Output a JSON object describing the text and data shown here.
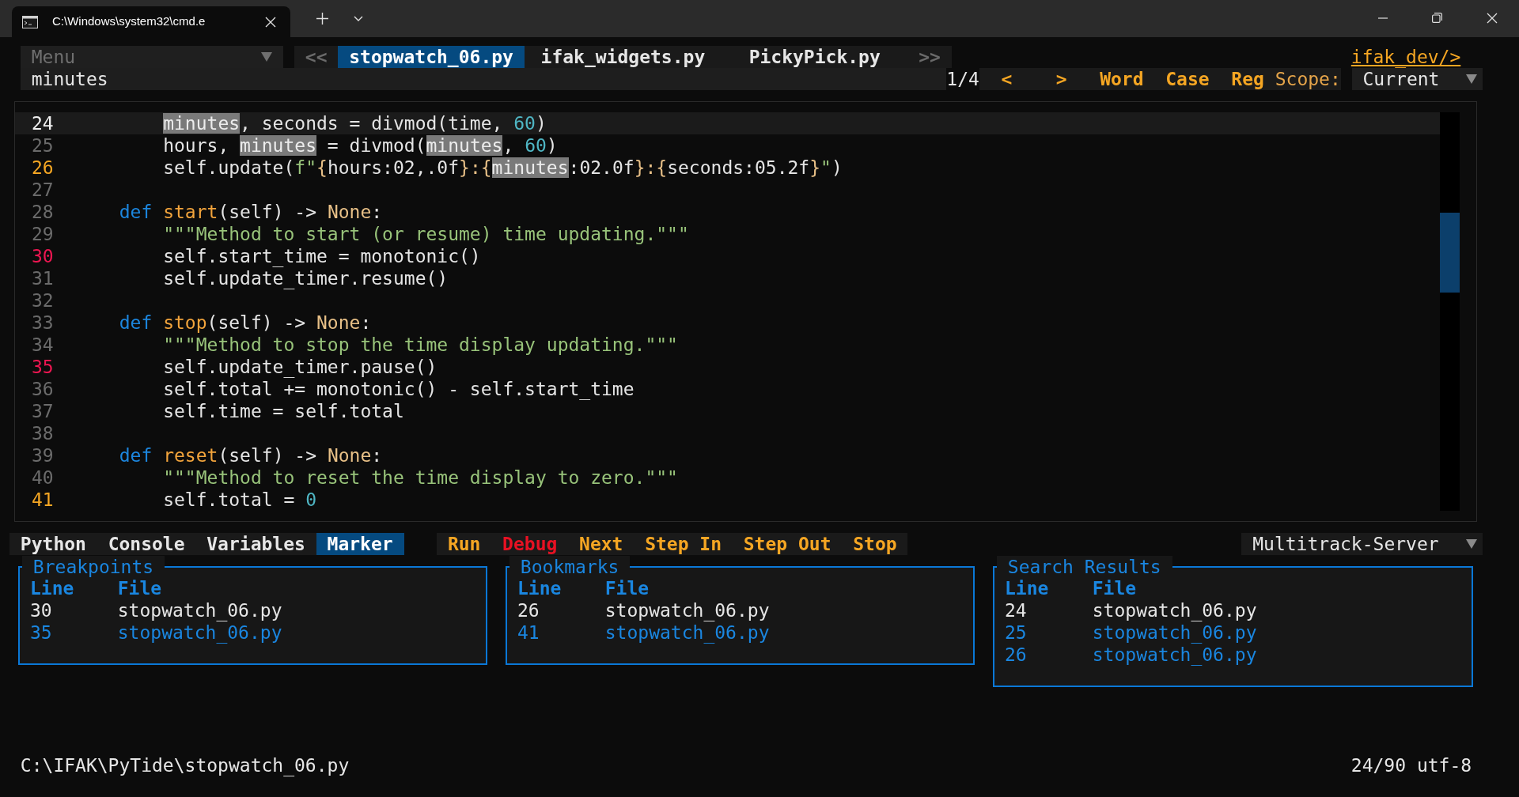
{
  "window": {
    "tab_title": "C:\\Windows\\system32\\cmd.e"
  },
  "menu": {
    "label": "Menu"
  },
  "file_tabs": {
    "prev": "<<",
    "next": ">>",
    "tabs": [
      {
        "label": "stopwatch_06.py",
        "selected": true
      },
      {
        "label": "ifak_widgets.py",
        "selected": false
      },
      {
        "label": "PickyPick.py",
        "selected": false
      }
    ]
  },
  "project_link": "ifak_dev/>",
  "search": {
    "value": "minutes",
    "count": "1/4",
    "prev": "<",
    "next": ">",
    "options": [
      "Word",
      "Case",
      "Reg"
    ],
    "scope_label": "Scope:",
    "scope": "Current"
  },
  "editor": {
    "lines": [
      {
        "number": "24",
        "current": true,
        "bookmark": false,
        "breakpoint": false,
        "tokens": [
          {
            "text": "minutes",
            "kind": "match"
          },
          {
            "text": ", seconds = divmod(time, ",
            "kind": "plain"
          },
          {
            "text": "60",
            "kind": "number"
          },
          {
            "text": ")",
            "kind": "plain"
          }
        ]
      },
      {
        "number": "25",
        "current": false,
        "bookmark": false,
        "breakpoint": false,
        "tokens": [
          {
            "text": "hours, ",
            "kind": "plain"
          },
          {
            "text": "minutes",
            "kind": "match"
          },
          {
            "text": " = divmod(",
            "kind": "plain"
          },
          {
            "text": "minutes",
            "kind": "match"
          },
          {
            "text": ", ",
            "kind": "plain"
          },
          {
            "text": "60",
            "kind": "number"
          },
          {
            "text": ")",
            "kind": "plain"
          }
        ]
      },
      {
        "number": "26",
        "current": false,
        "bookmark": true,
        "breakpoint": false,
        "tokens": [
          {
            "text": "self.update(",
            "kind": "plain"
          },
          {
            "text": "f\"",
            "kind": "string"
          },
          {
            "text": "{",
            "kind": "brace"
          },
          {
            "text": "hours:02,.0f",
            "kind": "plain"
          },
          {
            "text": "}:{",
            "kind": "brace"
          },
          {
            "text": "minutes",
            "kind": "match"
          },
          {
            "text": ":02.0f",
            "kind": "plain"
          },
          {
            "text": "}:{",
            "kind": "brace"
          },
          {
            "text": "seconds:05.2f",
            "kind": "plain"
          },
          {
            "text": "}",
            "kind": "brace"
          },
          {
            "text": "\"",
            "kind": "string"
          },
          {
            "text": ")",
            "kind": "plain"
          }
        ]
      },
      {
        "number": "27",
        "current": false,
        "bookmark": false,
        "breakpoint": false
      },
      {
        "number": "28",
        "current": false,
        "bookmark": false,
        "breakpoint": false,
        "tokens": [
          {
            "text": "def",
            "kind": "keyword"
          },
          {
            "text": "start",
            "kind": "function"
          },
          {
            "text": "(self) -> ",
            "kind": "plain"
          },
          {
            "text": "None",
            "kind": "type"
          },
          {
            "text": ":",
            "kind": "plain"
          }
        ]
      },
      {
        "number": "29",
        "current": false,
        "bookmark": false,
        "breakpoint": false,
        "tokens": [
          {
            "text": "\"\"\"Method to start (or resume) time updating.\"\"\"",
            "kind": "string"
          }
        ]
      },
      {
        "number": "30",
        "current": false,
        "bookmark": false,
        "breakpoint": true,
        "tokens": [
          {
            "text": "self.start_time = monotonic()",
            "kind": "plain"
          }
        ]
      },
      {
        "number": "31",
        "current": false,
        "bookmark": false,
        "breakpoint": false,
        "tokens": [
          {
            "text": "self.update_timer.resume()",
            "kind": "plain"
          }
        ]
      },
      {
        "number": "32",
        "current": false,
        "bookmark": false,
        "breakpoint": false
      },
      {
        "number": "33",
        "current": false,
        "bookmark": false,
        "breakpoint": false,
        "tokens": [
          {
            "text": "def",
            "kind": "keyword"
          },
          {
            "text": "stop",
            "kind": "function"
          },
          {
            "text": "(self) -> ",
            "kind": "plain"
          },
          {
            "text": "None",
            "kind": "type"
          },
          {
            "text": ":",
            "kind": "plain"
          }
        ]
      },
      {
        "number": "34",
        "current": false,
        "bookmark": false,
        "breakpoint": false,
        "tokens": [
          {
            "text": "\"\"\"Method to stop the time display updating.\"\"\"",
            "kind": "string"
          }
        ]
      },
      {
        "number": "35",
        "current": false,
        "bookmark": false,
        "breakpoint": true,
        "tokens": [
          {
            "text": "self.update_timer.pause()",
            "kind": "plain"
          }
        ]
      },
      {
        "number": "36",
        "current": false,
        "bookmark": false,
        "breakpoint": false,
        "tokens": [
          {
            "text": "self.total += monotonic() - self.start_time",
            "kind": "plain"
          }
        ]
      },
      {
        "number": "37",
        "current": false,
        "bookmark": false,
        "breakpoint": false,
        "tokens": [
          {
            "text": "self.time = self.total",
            "kind": "plain"
          }
        ]
      },
      {
        "number": "38",
        "current": false,
        "bookmark": false,
        "breakpoint": false
      },
      {
        "number": "39",
        "current": false,
        "bookmark": false,
        "breakpoint": false,
        "tokens": [
          {
            "text": "def",
            "kind": "keyword"
          },
          {
            "text": "reset",
            "kind": "function"
          },
          {
            "text": "(self) -> ",
            "kind": "plain"
          },
          {
            "text": "None",
            "kind": "type"
          },
          {
            "text": ":",
            "kind": "plain"
          }
        ]
      },
      {
        "number": "40",
        "current": false,
        "bookmark": false,
        "breakpoint": false,
        "tokens": [
          {
            "text": "\"\"\"Method to reset the time display to zero.\"\"\"",
            "kind": "string"
          }
        ]
      },
      {
        "number": "41",
        "current": false,
        "bookmark": true,
        "breakpoint": false,
        "tokens": [
          {
            "text": "self.total = ",
            "kind": "plain"
          },
          {
            "text": "0",
            "kind": "number"
          }
        ]
      }
    ]
  },
  "tool_tabs": [
    {
      "label": "Python",
      "selected": false
    },
    {
      "label": "Console",
      "selected": false
    },
    {
      "label": "Variables",
      "selected": false
    },
    {
      "label": "Marker",
      "selected": true
    }
  ],
  "run_controls": [
    {
      "label": "Run",
      "active": false
    },
    {
      "label": "Debug",
      "active": true
    },
    {
      "label": "Next",
      "active": false
    },
    {
      "label": "Step In",
      "active": false
    },
    {
      "label": "Step Out",
      "active": false
    },
    {
      "label": "Stop",
      "active": false
    }
  ],
  "server": {
    "label": "Multitrack-Server"
  },
  "panels": [
    {
      "title": "Breakpoints",
      "columns": [
        "Line",
        "File"
      ],
      "rows": [
        {
          "line": "30",
          "file": "stopwatch_06.py",
          "selected": true
        },
        {
          "line": "35",
          "file": "stopwatch_06.py",
          "selected": false
        }
      ]
    },
    {
      "title": "Bookmarks",
      "columns": [
        "Line",
        "File"
      ],
      "rows": [
        {
          "line": "26",
          "file": "stopwatch_06.py",
          "selected": true
        },
        {
          "line": "41",
          "file": "stopwatch_06.py",
          "selected": false
        }
      ]
    },
    {
      "title": "Search Results",
      "columns": [
        "Line",
        "File"
      ],
      "rows": [
        {
          "line": "24",
          "file": "stopwatch_06.py",
          "selected": true
        },
        {
          "line": "25",
          "file": "stopwatch_06.py",
          "selected": false
        },
        {
          "line": "26",
          "file": "stopwatch_06.py",
          "selected": false
        }
      ]
    }
  ],
  "status_bar": {
    "path": "C:\\IFAK\\PyTide\\stopwatch_06.py",
    "position": "24/90 utf-8"
  }
}
